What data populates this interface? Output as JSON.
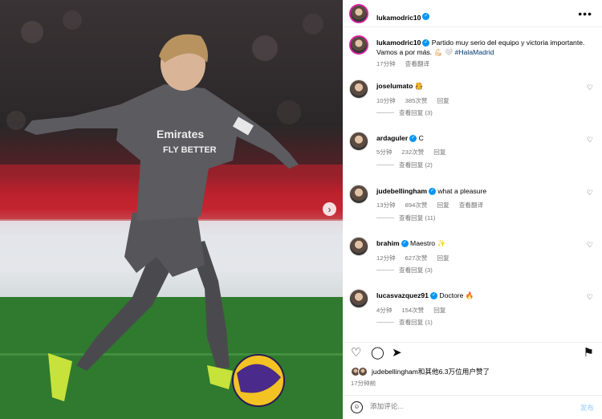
{
  "post": {
    "author": "lukamodric10",
    "more_icon": "more-horizontal-icon",
    "caption_user": "lukamodric10",
    "caption_text": "Partido muy serio del equipo y victoria importante. Vamos a por más. 💪🏻 🤍",
    "caption_hashtag": "#HalaMadrid",
    "caption_time": "17分钟",
    "caption_translate": "查看翻译"
  },
  "comments": [
    {
      "user": "joselumato",
      "text": "🫅",
      "time": "10分钟",
      "likes": "385次赞",
      "reply": "回复",
      "translate": "",
      "view_replies": "查看回复 (3)"
    },
    {
      "user": "ardaguler",
      "text": "C",
      "time": "5分钟",
      "likes": "232次赞",
      "reply": "回复",
      "translate": "",
      "view_replies": "查看回复 (2)"
    },
    {
      "user": "judebellingham",
      "text": "what a pleasure",
      "time": "13分钟",
      "likes": "894次赞",
      "reply": "回复",
      "translate": "查看翻译",
      "view_replies": "查看回复 (11)"
    },
    {
      "user": "brahim",
      "text": "Maestro ✨",
      "time": "12分钟",
      "likes": "627次赞",
      "reply": "回复",
      "translate": "",
      "view_replies": "查看回复 (3)"
    },
    {
      "user": "lucasvazquez91",
      "text": "Doctore 🔥",
      "time": "4分钟",
      "likes": "154次赞",
      "reply": "回复",
      "translate": "",
      "view_replies": "查看回复 (1)"
    }
  ],
  "actions": {
    "like_icon": "♡",
    "comment_icon": "◯",
    "share_icon": "➤",
    "save_icon": "⚑"
  },
  "likes_text": "judebellingham和其他6.3万位用户赞了",
  "post_time": "17分钟前",
  "comment_box": {
    "emoji": "☺",
    "placeholder": "添加评论...",
    "post_label": "发布"
  },
  "colors": {
    "verified": "#0095f6",
    "hashtag": "#00376b",
    "muted": "#737373",
    "story_ring": "#d6249f"
  }
}
